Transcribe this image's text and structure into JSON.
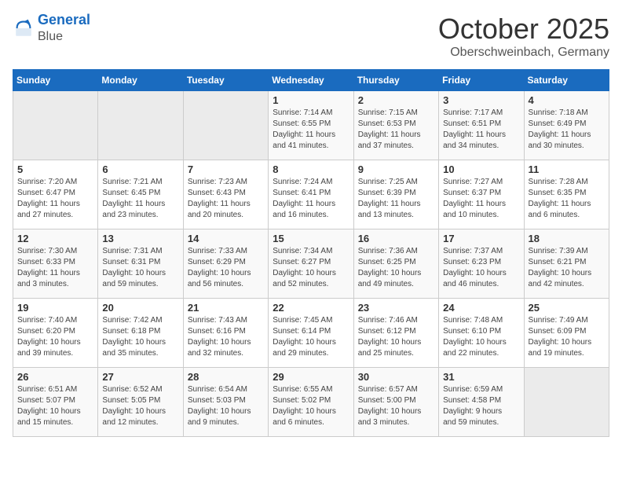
{
  "logo": {
    "line1": "General",
    "line2": "Blue"
  },
  "title": "October 2025",
  "subtitle": "Oberschweinbach, Germany",
  "weekdays": [
    "Sunday",
    "Monday",
    "Tuesday",
    "Wednesday",
    "Thursday",
    "Friday",
    "Saturday"
  ],
  "weeks": [
    [
      {
        "day": "",
        "info": ""
      },
      {
        "day": "",
        "info": ""
      },
      {
        "day": "",
        "info": ""
      },
      {
        "day": "1",
        "info": "Sunrise: 7:14 AM\nSunset: 6:55 PM\nDaylight: 11 hours\nand 41 minutes."
      },
      {
        "day": "2",
        "info": "Sunrise: 7:15 AM\nSunset: 6:53 PM\nDaylight: 11 hours\nand 37 minutes."
      },
      {
        "day": "3",
        "info": "Sunrise: 7:17 AM\nSunset: 6:51 PM\nDaylight: 11 hours\nand 34 minutes."
      },
      {
        "day": "4",
        "info": "Sunrise: 7:18 AM\nSunset: 6:49 PM\nDaylight: 11 hours\nand 30 minutes."
      }
    ],
    [
      {
        "day": "5",
        "info": "Sunrise: 7:20 AM\nSunset: 6:47 PM\nDaylight: 11 hours\nand 27 minutes."
      },
      {
        "day": "6",
        "info": "Sunrise: 7:21 AM\nSunset: 6:45 PM\nDaylight: 11 hours\nand 23 minutes."
      },
      {
        "day": "7",
        "info": "Sunrise: 7:23 AM\nSunset: 6:43 PM\nDaylight: 11 hours\nand 20 minutes."
      },
      {
        "day": "8",
        "info": "Sunrise: 7:24 AM\nSunset: 6:41 PM\nDaylight: 11 hours\nand 16 minutes."
      },
      {
        "day": "9",
        "info": "Sunrise: 7:25 AM\nSunset: 6:39 PM\nDaylight: 11 hours\nand 13 minutes."
      },
      {
        "day": "10",
        "info": "Sunrise: 7:27 AM\nSunset: 6:37 PM\nDaylight: 11 hours\nand 10 minutes."
      },
      {
        "day": "11",
        "info": "Sunrise: 7:28 AM\nSunset: 6:35 PM\nDaylight: 11 hours\nand 6 minutes."
      }
    ],
    [
      {
        "day": "12",
        "info": "Sunrise: 7:30 AM\nSunset: 6:33 PM\nDaylight: 11 hours\nand 3 minutes."
      },
      {
        "day": "13",
        "info": "Sunrise: 7:31 AM\nSunset: 6:31 PM\nDaylight: 10 hours\nand 59 minutes."
      },
      {
        "day": "14",
        "info": "Sunrise: 7:33 AM\nSunset: 6:29 PM\nDaylight: 10 hours\nand 56 minutes."
      },
      {
        "day": "15",
        "info": "Sunrise: 7:34 AM\nSunset: 6:27 PM\nDaylight: 10 hours\nand 52 minutes."
      },
      {
        "day": "16",
        "info": "Sunrise: 7:36 AM\nSunset: 6:25 PM\nDaylight: 10 hours\nand 49 minutes."
      },
      {
        "day": "17",
        "info": "Sunrise: 7:37 AM\nSunset: 6:23 PM\nDaylight: 10 hours\nand 46 minutes."
      },
      {
        "day": "18",
        "info": "Sunrise: 7:39 AM\nSunset: 6:21 PM\nDaylight: 10 hours\nand 42 minutes."
      }
    ],
    [
      {
        "day": "19",
        "info": "Sunrise: 7:40 AM\nSunset: 6:20 PM\nDaylight: 10 hours\nand 39 minutes."
      },
      {
        "day": "20",
        "info": "Sunrise: 7:42 AM\nSunset: 6:18 PM\nDaylight: 10 hours\nand 35 minutes."
      },
      {
        "day": "21",
        "info": "Sunrise: 7:43 AM\nSunset: 6:16 PM\nDaylight: 10 hours\nand 32 minutes."
      },
      {
        "day": "22",
        "info": "Sunrise: 7:45 AM\nSunset: 6:14 PM\nDaylight: 10 hours\nand 29 minutes."
      },
      {
        "day": "23",
        "info": "Sunrise: 7:46 AM\nSunset: 6:12 PM\nDaylight: 10 hours\nand 25 minutes."
      },
      {
        "day": "24",
        "info": "Sunrise: 7:48 AM\nSunset: 6:10 PM\nDaylight: 10 hours\nand 22 minutes."
      },
      {
        "day": "25",
        "info": "Sunrise: 7:49 AM\nSunset: 6:09 PM\nDaylight: 10 hours\nand 19 minutes."
      }
    ],
    [
      {
        "day": "26",
        "info": "Sunrise: 6:51 AM\nSunset: 5:07 PM\nDaylight: 10 hours\nand 15 minutes."
      },
      {
        "day": "27",
        "info": "Sunrise: 6:52 AM\nSunset: 5:05 PM\nDaylight: 10 hours\nand 12 minutes."
      },
      {
        "day": "28",
        "info": "Sunrise: 6:54 AM\nSunset: 5:03 PM\nDaylight: 10 hours\nand 9 minutes."
      },
      {
        "day": "29",
        "info": "Sunrise: 6:55 AM\nSunset: 5:02 PM\nDaylight: 10 hours\nand 6 minutes."
      },
      {
        "day": "30",
        "info": "Sunrise: 6:57 AM\nSunset: 5:00 PM\nDaylight: 10 hours\nand 3 minutes."
      },
      {
        "day": "31",
        "info": "Sunrise: 6:59 AM\nSunset: 4:58 PM\nDaylight: 9 hours\nand 59 minutes."
      },
      {
        "day": "",
        "info": ""
      }
    ]
  ]
}
